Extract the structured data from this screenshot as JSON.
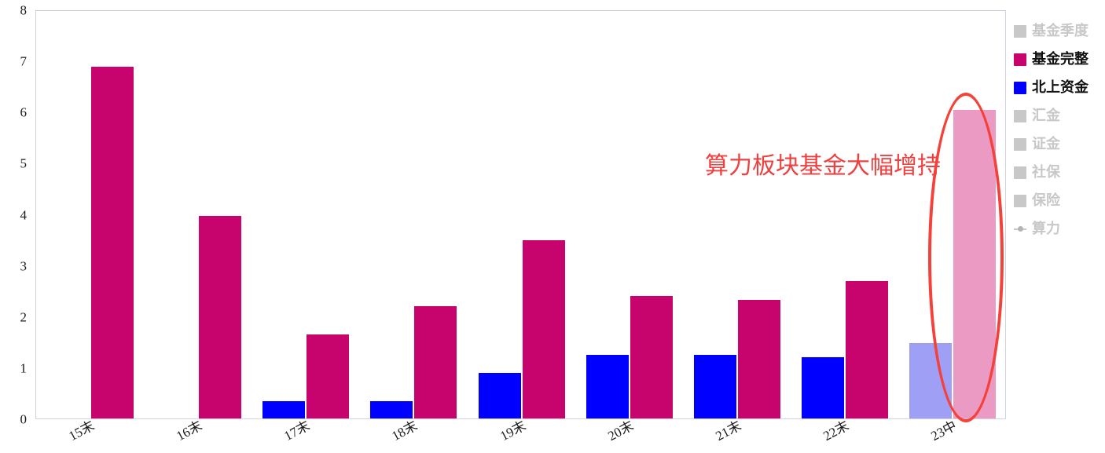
{
  "chart_data": {
    "type": "bar",
    "title": "",
    "subtitle": "",
    "xlabel": "",
    "ylabel": "",
    "ylim": [
      0,
      8
    ],
    "yticks": [
      0,
      1,
      2,
      3,
      4,
      5,
      6,
      7,
      8
    ],
    "ytick_labels": [
      "0",
      "1",
      "2",
      "3",
      "4",
      "5",
      "6",
      "7",
      "8"
    ],
    "grid": false,
    "legend_position": "right",
    "categories": [
      "15末",
      "16末",
      "17末",
      "18末",
      "19末",
      "20末",
      "21末",
      "22末",
      "23中"
    ],
    "series": [
      {
        "name": "北上资金",
        "color": "#0000ff",
        "highlight_color": "#9f9ff5",
        "values": [
          null,
          null,
          0.34,
          0.34,
          0.89,
          1.24,
          1.25,
          1.2,
          1.47
        ]
      },
      {
        "name": "基金完整",
        "color": "#c7036e",
        "highlight_color": "#eb9ac3",
        "values": [
          6.88,
          3.96,
          1.65,
          2.2,
          3.48,
          2.39,
          2.32,
          2.69,
          6.03
        ]
      }
    ],
    "highlighted_category": "23中",
    "annotations": [
      {
        "text": "算力板块基金大幅增持",
        "color": "#ef4040",
        "type": "text"
      },
      {
        "text": "",
        "color": "#f4423a",
        "type": "ellipse-highlight",
        "target": "23中"
      }
    ]
  },
  "legend": {
    "items": [
      {
        "label": "基金季度",
        "color": "#c8c8c8",
        "marker": "square",
        "state": "dimmed"
      },
      {
        "label": "基金完整",
        "color": "#c7036e",
        "marker": "square",
        "state": "active"
      },
      {
        "label": "北上资金",
        "color": "#0000ff",
        "marker": "square",
        "state": "active"
      },
      {
        "label": "汇金",
        "color": "#c8c8c8",
        "marker": "square",
        "state": "dimmed"
      },
      {
        "label": "证金",
        "color": "#c8c8c8",
        "marker": "square",
        "state": "dimmed"
      },
      {
        "label": "社保",
        "color": "#c8c8c8",
        "marker": "square",
        "state": "dimmed"
      },
      {
        "label": "保险",
        "color": "#c8c8c8",
        "marker": "square",
        "state": "dimmed"
      },
      {
        "label": "算力",
        "color": "#c8c8c8",
        "marker": "line",
        "state": "dimmed"
      }
    ]
  }
}
